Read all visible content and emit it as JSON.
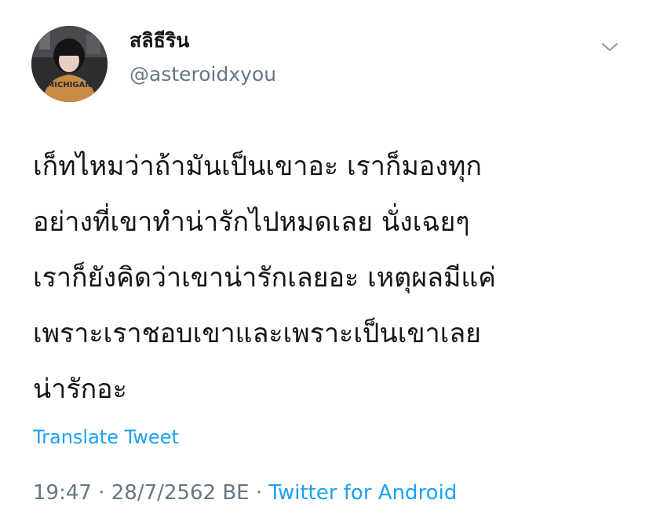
{
  "author": {
    "display_name": "สลิธีริน",
    "handle": "@asteroidxyou",
    "avatar_icon": "profile-photo"
  },
  "menu": {
    "caret_icon": "chevron-down-icon"
  },
  "tweet": {
    "lines": [
      "เก็ทไหมว่าถ้ามันเป็นเขาอะ เราก็มองทุก",
      "อย่างที่เขาทำน่ารักไปหมดเลย นั่งเฉยๆ",
      "เราก็ยังคิดว่าเขาน่ารักเลยอะ เหตุผลมีแค่",
      "เพราะเราชอบเขาและเพราะเป็นเขาเลย",
      "น่ารักอะ"
    ]
  },
  "translate_label": "Translate Tweet",
  "meta": {
    "time": "19:47",
    "separator": "·",
    "date": "28/7/2562 BE",
    "source": "Twitter for Android"
  },
  "colors": {
    "text": "#14171a",
    "secondary": "#657786",
    "link": "#1da1f2"
  }
}
